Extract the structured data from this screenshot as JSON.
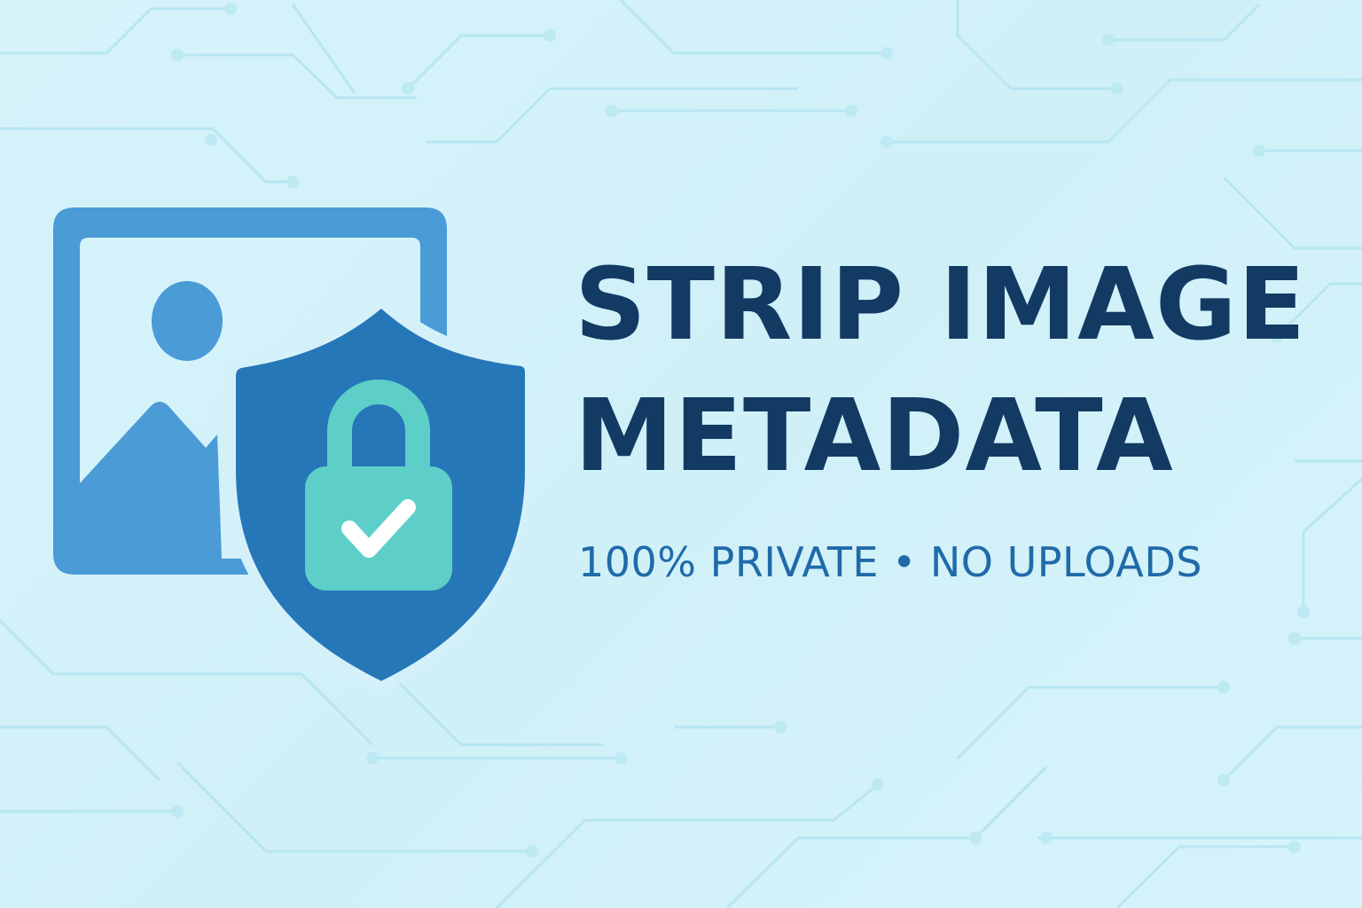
{
  "banner": {
    "title_line_1": "STRIP IMAGE",
    "title_line_2": "METADATA",
    "subtitle": "100% PRIVATE • NO UPLOADS"
  },
  "icons": [
    "image-icon",
    "shield-icon",
    "padlock-icon",
    "checkmark-icon"
  ],
  "colors": {
    "background": "#d4f1f9",
    "circuit_lines": "#b6e6f1",
    "image_frame": "#4a9bd6",
    "shield": "#2677b8",
    "padlock": "#5ecfc8",
    "checkmark": "#ffffff",
    "title": "#123a63",
    "subtitle": "#1f6aa9"
  }
}
